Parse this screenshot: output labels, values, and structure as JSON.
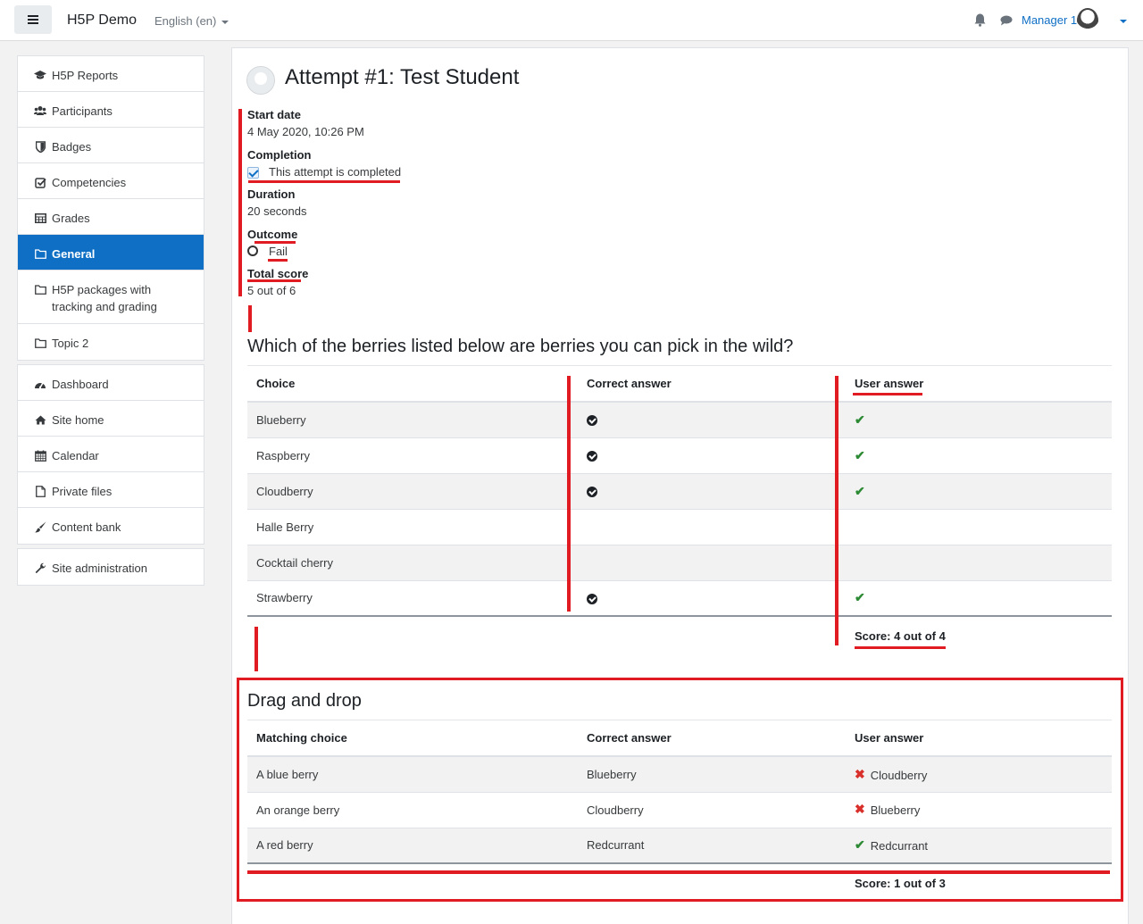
{
  "navbar": {
    "site_name": "H5P Demo",
    "language": "English (en)",
    "user_name": "Manager 1"
  },
  "sidebar": {
    "groups": [
      [
        {
          "label": "H5P Reports",
          "icon": "graduation-cap-icon"
        },
        {
          "label": "Participants",
          "icon": "users-icon"
        },
        {
          "label": "Badges",
          "icon": "shield-icon"
        },
        {
          "label": "Competencies",
          "icon": "check-square-icon"
        },
        {
          "label": "Grades",
          "icon": "table-icon"
        },
        {
          "label": "General",
          "icon": "folder-icon",
          "active": true
        },
        {
          "label": "H5P packages with tracking and grading",
          "icon": "folder-icon"
        },
        {
          "label": "Topic 2",
          "icon": "folder-icon"
        }
      ],
      [
        {
          "label": "Dashboard",
          "icon": "dashboard-icon"
        },
        {
          "label": "Site home",
          "icon": "home-icon"
        },
        {
          "label": "Calendar",
          "icon": "calendar-icon"
        },
        {
          "label": "Private files",
          "icon": "file-icon"
        },
        {
          "label": "Content bank",
          "icon": "paint-brush-icon"
        }
      ],
      [
        {
          "label": "Site administration",
          "icon": "wrench-icon"
        }
      ]
    ]
  },
  "attempt": {
    "title": "Attempt #1: Test Student",
    "start_date_label": "Start date",
    "start_date_value": "4 May 2020, 10:26 PM",
    "completion_label": "Completion",
    "completion_value": "This attempt is completed",
    "duration_label": "Duration",
    "duration_value": "20 seconds",
    "outcome_label": "Outcome",
    "outcome_value": "Fail",
    "total_score_label": "Total score",
    "total_score_value": "5 out of 6"
  },
  "question1": {
    "title": "Which of the berries listed below are berries you can pick in the wild?",
    "headers": [
      "Choice",
      "Correct answer",
      "User answer"
    ],
    "rows": [
      {
        "choice": "Blueberry",
        "correct": true,
        "user": true
      },
      {
        "choice": "Raspberry",
        "correct": true,
        "user": true
      },
      {
        "choice": "Cloudberry",
        "correct": true,
        "user": true
      },
      {
        "choice": "Halle Berry",
        "correct": false,
        "user": false
      },
      {
        "choice": "Cocktail cherry",
        "correct": false,
        "user": false
      },
      {
        "choice": "Strawberry",
        "correct": true,
        "user": true
      }
    ],
    "score": "Score: 4 out of 4"
  },
  "question2": {
    "title": "Drag and drop",
    "headers": [
      "Matching choice",
      "Correct answer",
      "User answer"
    ],
    "rows": [
      {
        "choice": "A blue berry",
        "correct": "Blueberry",
        "user": "Cloudberry",
        "user_correct": false
      },
      {
        "choice": "An orange berry",
        "correct": "Cloudberry",
        "user": "Blueberry",
        "user_correct": false
      },
      {
        "choice": "A red berry",
        "correct": "Redcurrant",
        "user": "Redcurrant",
        "user_correct": true
      }
    ],
    "score": "Score: 1 out of 3"
  },
  "colors": {
    "accent": "#0f6fc5",
    "annotation_red": "#e11b22",
    "check_green": "#2d8a34",
    "cross_red": "#d9302b"
  }
}
